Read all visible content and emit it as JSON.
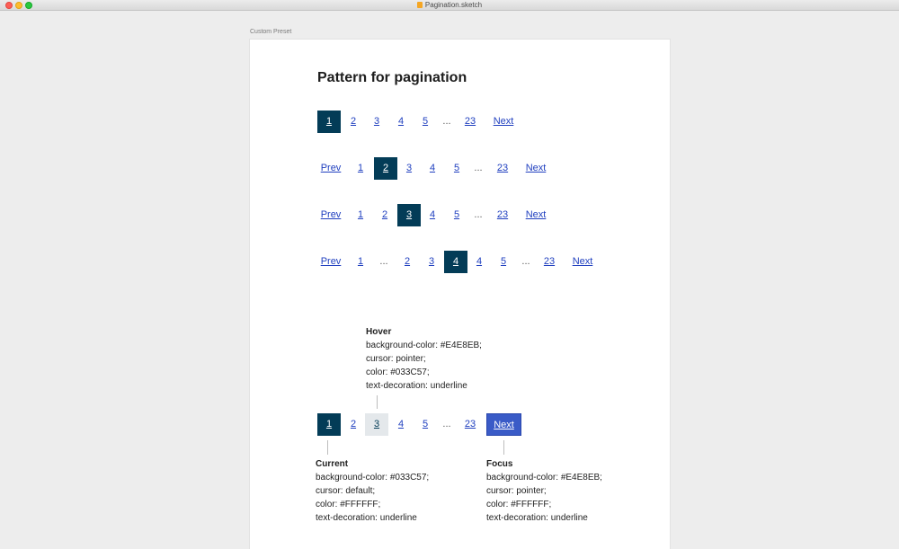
{
  "window": {
    "title": "Pagination.sketch"
  },
  "preset_label": "Custom Preset",
  "heading": "Pattern for pagination",
  "labels": {
    "prev": "Prev",
    "next": "Next",
    "ellipsis": "..."
  },
  "pages": {
    "p1": "1",
    "p2": "2",
    "p3": "3",
    "p4": "4",
    "p5": "5",
    "last": "23"
  },
  "notes": {
    "hover": {
      "title": "Hover",
      "lines": [
        "background-color: #E4E8EB;",
        "cursor: pointer;",
        "color: #033C57;",
        "text-decoration: underline"
      ]
    },
    "current": {
      "title": "Current",
      "lines": [
        "background-color: #033C57;",
        "cursor: default;",
        "color: #FFFFFF;",
        "text-decoration: underline"
      ]
    },
    "focus": {
      "title": "Focus",
      "lines": [
        "background-color: #E4E8EB;",
        "cursor: pointer;",
        "color: #FFFFFF;",
        "text-decoration: underline"
      ]
    }
  },
  "colors": {
    "current_bg": "#033C57",
    "hover_bg": "#E4E8EB",
    "focus_bg": "#3A5BC7",
    "link": "#1F3FBF"
  }
}
